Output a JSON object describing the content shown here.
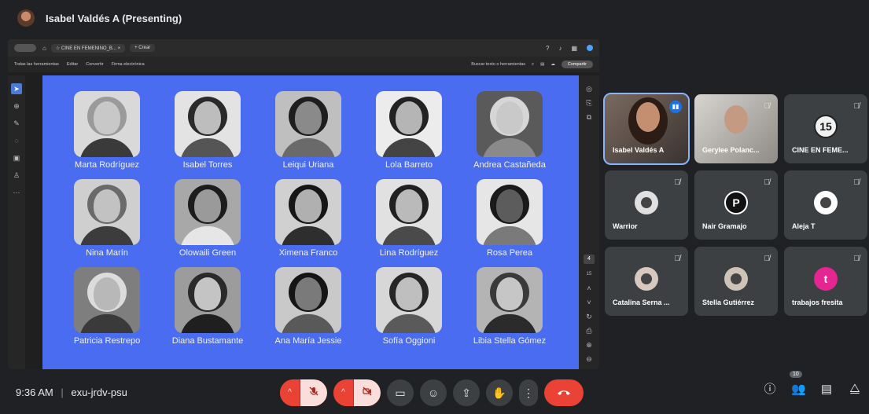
{
  "presenter": {
    "title": "Isabel Valdés A (Presenting)"
  },
  "browser": {
    "tab_title": "CINE EN FEMENINO_B...",
    "tab_close": "×",
    "new_tab": "+ Crear",
    "tools_menu": [
      "Todas las herramientas",
      "Editar",
      "Convertir",
      "Firma electrónica"
    ],
    "search_placeholder": "Buscar texto o herramientas",
    "share_label": "Compartir",
    "page_number": "4",
    "page_total": "15"
  },
  "slide": {
    "people": [
      {
        "name": "Marta Rodríguez",
        "hair": "#9a9a9a",
        "skin": "#c8c8c8",
        "bg": "#d9d9d9",
        "shirt": "#3a3a3a"
      },
      {
        "name": "Isabel Torres",
        "hair": "#2a2a2a",
        "skin": "#bdbdbd",
        "bg": "#e3e3e3",
        "shirt": "#555555"
      },
      {
        "name": "Leiqui Uriana",
        "hair": "#1e1e1e",
        "skin": "#8a8a8a",
        "bg": "#bfbfbf",
        "shirt": "#6a6a6a"
      },
      {
        "name": "Lola Barreto",
        "hair": "#222222",
        "skin": "#b5b5b5",
        "bg": "#ececec",
        "shirt": "#444444"
      },
      {
        "name": "Andrea Castañeda",
        "hair": "#d6d6d6",
        "skin": "#c9c9c9",
        "bg": "#5a5a5a",
        "shirt": "#8a8a8a"
      },
      {
        "name": "Nina Marín",
        "hair": "#6a6a6a",
        "skin": "#c2c2c2",
        "bg": "#cfcfcf",
        "shirt": "#3c3c3c"
      },
      {
        "name": "Olowaili Green",
        "hair": "#1c1c1c",
        "skin": "#9a9a9a",
        "bg": "#a8a8a8",
        "shirt": "#e6e6e6"
      },
      {
        "name": "Ximena Franco",
        "hair": "#161616",
        "skin": "#b0b0b0",
        "bg": "#d0d0d0",
        "shirt": "#2e2e2e"
      },
      {
        "name": "Lina Rodríguez",
        "hair": "#202020",
        "skin": "#bababa",
        "bg": "#e1e1e1",
        "shirt": "#4a4a4a"
      },
      {
        "name": "Rosa Perea",
        "hair": "#1a1a1a",
        "skin": "#5c5c5c",
        "bg": "#e6e6e6",
        "shirt": "#7a7a7a"
      },
      {
        "name": "Patricia Restrepo",
        "hair": "#dcdcdc",
        "skin": "#b8b8b8",
        "bg": "#7e7e7e",
        "shirt": "#3a3a3a"
      },
      {
        "name": "Diana Bustamante",
        "hair": "#2a2a2a",
        "skin": "#c4c4c4",
        "bg": "#9c9c9c",
        "shirt": "#1f1f1f"
      },
      {
        "name": "Ana María Jessie",
        "hair": "#151515",
        "skin": "#7a7a7a",
        "bg": "#c9c9c9",
        "shirt": "#595959"
      },
      {
        "name": "Sofía Oggioni",
        "hair": "#262626",
        "skin": "#bfbfbf",
        "bg": "#d7d7d7",
        "shirt": "#5a5a5a"
      },
      {
        "name": "Libia Stella Gómez",
        "hair": "#3a3a3a",
        "skin": "#c6c6c6",
        "bg": "#b4b4b4",
        "shirt": "#2b2b2b"
      }
    ]
  },
  "participants": [
    {
      "name": "Isabel Valdés A",
      "type": "video-a",
      "speaking": true
    },
    {
      "name": "Gerylee Polanc...",
      "type": "video-b",
      "speaking": false,
      "muted": true
    },
    {
      "name": "CINE EN FEME...",
      "type": "badge",
      "initial": "15",
      "muted": true
    },
    {
      "name": "Warrior",
      "type": "avatar",
      "color": "#e0e0e0",
      "muted": true
    },
    {
      "name": "Nair Gramajo",
      "type": "avatar",
      "initial": "P",
      "color": "#111111",
      "muted": true
    },
    {
      "name": "Aleja T",
      "type": "avatar",
      "color": "#ffffff",
      "muted": true
    },
    {
      "name": "Catalina Serna ...",
      "type": "avatar",
      "color": "#d8c8c0",
      "muted": true
    },
    {
      "name": "Stella Gutiérrez",
      "type": "avatar",
      "color": "#cfc3b8",
      "muted": true
    },
    {
      "name": "trabajos fresita",
      "type": "avatar",
      "initial": "t",
      "color": "#e52592",
      "muted": true
    }
  ],
  "meeting": {
    "time": "9:36 AM",
    "separator": "|",
    "code": "exu-jrdv-psu",
    "participant_count": "10"
  },
  "icons": {
    "mic_off": "🎙",
    "cam_off": "⊘",
    "caret": "^",
    "end_call": "☎"
  }
}
